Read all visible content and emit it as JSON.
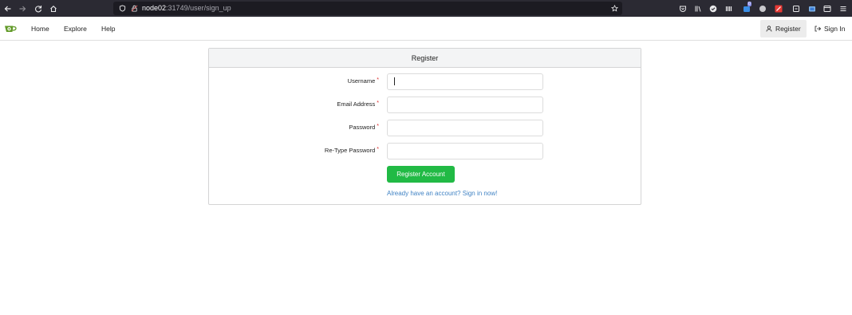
{
  "browser": {
    "url_host": "node02",
    "url_path": ":31749/user/sign_up",
    "extension_badge": "0"
  },
  "header": {
    "nav": [
      {
        "label": "Home"
      },
      {
        "label": "Explore"
      },
      {
        "label": "Help"
      }
    ],
    "register_label": "Register",
    "signin_label": "Sign In"
  },
  "form": {
    "title": "Register",
    "fields": [
      {
        "label": "Username",
        "required": "*",
        "value": ""
      },
      {
        "label": "Email Address",
        "required": "*",
        "value": ""
      },
      {
        "label": "Password",
        "required": "*",
        "value": ""
      },
      {
        "label": "Re-Type Password",
        "required": "*",
        "value": ""
      }
    ],
    "submit_label": "Register Account",
    "signin_text": "Already have an account? Sign in now!"
  },
  "colors": {
    "primary_button": "#21ba45",
    "link": "#4183c4",
    "required": "#db2828",
    "browser_bar": "#2b2a33"
  }
}
